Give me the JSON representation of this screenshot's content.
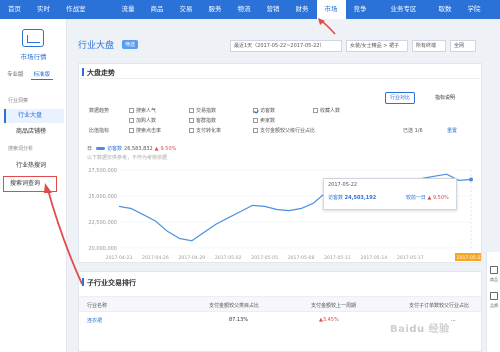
{
  "topnav": {
    "items": [
      "首页",
      "实时",
      "作战室",
      "流量",
      "商品",
      "交易",
      "服务",
      "物流",
      "营销",
      "财务",
      "市场",
      "竞争",
      "业务专区",
      "取数",
      "学院"
    ],
    "active_index": 10,
    "dropdown_index": 12,
    "badge_index": 12
  },
  "sidebar": {
    "title": "市场行情",
    "tabs": [
      "专业版",
      "标准版"
    ],
    "group_industry": "行业洞察",
    "item_market": "行业大盘",
    "item_goods": "商品店铺榜",
    "group_search": "搜索词分析",
    "item_hotwords": "行业热搜词",
    "item_query": "搜索词查询"
  },
  "header": {
    "title": "行业大盘",
    "badge": "筛选",
    "date_range": "最近1天（2017-05-22~2017-05-22）",
    "category": "女装/女士精品 > 裙子",
    "terminal": "所有终端",
    "scope": "全网"
  },
  "trend": {
    "title": "大盘走势",
    "compare_btn": "行业对比",
    "explain": "指标说明",
    "metric_group1": "数据趋势",
    "metric_group2": "比值指标",
    "metrics": [
      {
        "label": "搜索人气",
        "checked": false
      },
      {
        "label": "交易指数",
        "checked": false
      },
      {
        "label": "访客数",
        "checked": true
      },
      {
        "label": "收藏人数",
        "checked": false
      },
      {
        "label": "加购人数",
        "checked": false
      },
      {
        "label": "客群指数",
        "checked": false
      },
      {
        "label": "卖家数",
        "checked": false
      },
      {
        "label": "搜索点击率",
        "checked": false
      },
      {
        "label": "支付转化率",
        "checked": false
      },
      {
        "label": "支付金额较父级行业占比",
        "checked": false
      }
    ],
    "selected_label": "已选 1/6",
    "reset": "重置",
    "legend_prefix": "日",
    "series_name": "访客数",
    "series_value": "26,583,832",
    "series_change": "9.50%",
    "note": "以下数据仅供参考，不作为考核依据",
    "tooltip": {
      "date": "2017-05-22",
      "label1": "访客数",
      "value1": "24,503,192",
      "label2": "较前一日",
      "value2": "9.50%"
    }
  },
  "chart_data": {
    "type": "line",
    "x": [
      "2017-04-23",
      "2017-04-24",
      "2017-04-25",
      "2017-04-26",
      "2017-04-27",
      "2017-04-28",
      "2017-04-29",
      "2017-04-30",
      "2017-05-01",
      "2017-05-02",
      "2017-05-03",
      "2017-05-04",
      "2017-05-05",
      "2017-05-06",
      "2017-05-07",
      "2017-05-08",
      "2017-05-09",
      "2017-05-10",
      "2017-05-11",
      "2017-05-12",
      "2017-05-13",
      "2017-05-14",
      "2017-05-15",
      "2017-05-16",
      "2017-05-17",
      "2017-05-18",
      "2017-05-19",
      "2017-05-20",
      "2017-05-21",
      "2017-05-22"
    ],
    "tick_labels": [
      "2017-04-23",
      "2017-04-26",
      "2017-04-29",
      "2017-05-02",
      "2017-05-05",
      "2017-05-08",
      "2017-05-11",
      "2017-05-14",
      "2017-05-17",
      "2017-05-22"
    ],
    "series": [
      {
        "name": "访客数",
        "values": [
          24000000,
          23800000,
          23200000,
          22600000,
          21600000,
          20900000,
          20700000,
          21500000,
          22300000,
          22900000,
          23500000,
          24100000,
          24000000,
          23700000,
          23600000,
          23800000,
          24300000,
          25300000,
          25100000,
          25500000,
          25600000,
          25600000,
          25900000,
          26200000,
          26400000,
          26700000,
          26900000,
          27100000,
          26500000,
          26583832
        ]
      }
    ],
    "ylim": [
      20000000,
      27500000
    ],
    "y_ticks": [
      "20,000,000",
      "22,500,000",
      "25,000,000",
      "27,500,000"
    ],
    "y_tick_values": [
      20000000,
      22500000,
      25000000,
      27500000
    ],
    "grid": true
  },
  "ranking": {
    "title": "子行业交易排行",
    "columns": [
      "行业名称",
      "支付金额较父类目占比",
      "支付金额较上一周期",
      "支付子订单数较父行业占比"
    ],
    "rows": [
      {
        "name": "连衣裙",
        "share": "87.13%",
        "change": "3.45%",
        "orders": "..."
      }
    ]
  },
  "rightbar": {
    "label1": "商品",
    "label2": "品牌"
  },
  "watermark": "Baidu 经验",
  "colors": {
    "primary": "#2a71d8",
    "line": "#4a90e2",
    "highlight": "#f5a623",
    "arrow": "#e24b4b"
  }
}
